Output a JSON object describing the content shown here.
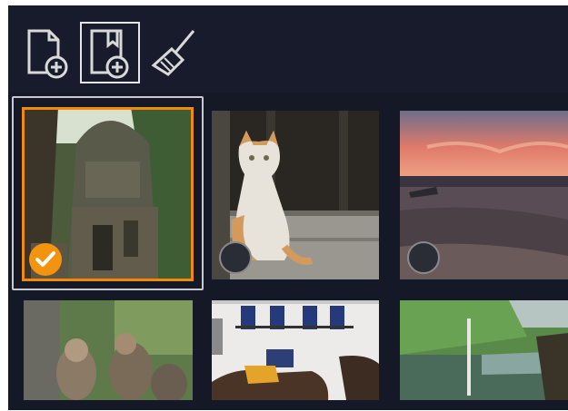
{
  "toolbar": {
    "tools": [
      {
        "name": "add-file",
        "selected": false
      },
      {
        "name": "add-image",
        "selected": true
      },
      {
        "name": "clear-broom",
        "selected": false
      }
    ]
  },
  "thumbnails": [
    {
      "subject": "temple",
      "selected": true
    },
    {
      "subject": "cat",
      "selected": false
    },
    {
      "subject": "sunset-lake",
      "selected": false
    },
    {
      "subject": "monkeys",
      "selected": false
    },
    {
      "subject": "white-building-horses",
      "selected": false
    },
    {
      "subject": "lake-forest",
      "selected": false
    }
  ],
  "colors": {
    "panel_background": "#171b2b",
    "selection_accent": "#f08a0c",
    "icon_stroke": "#d9d9d9"
  }
}
